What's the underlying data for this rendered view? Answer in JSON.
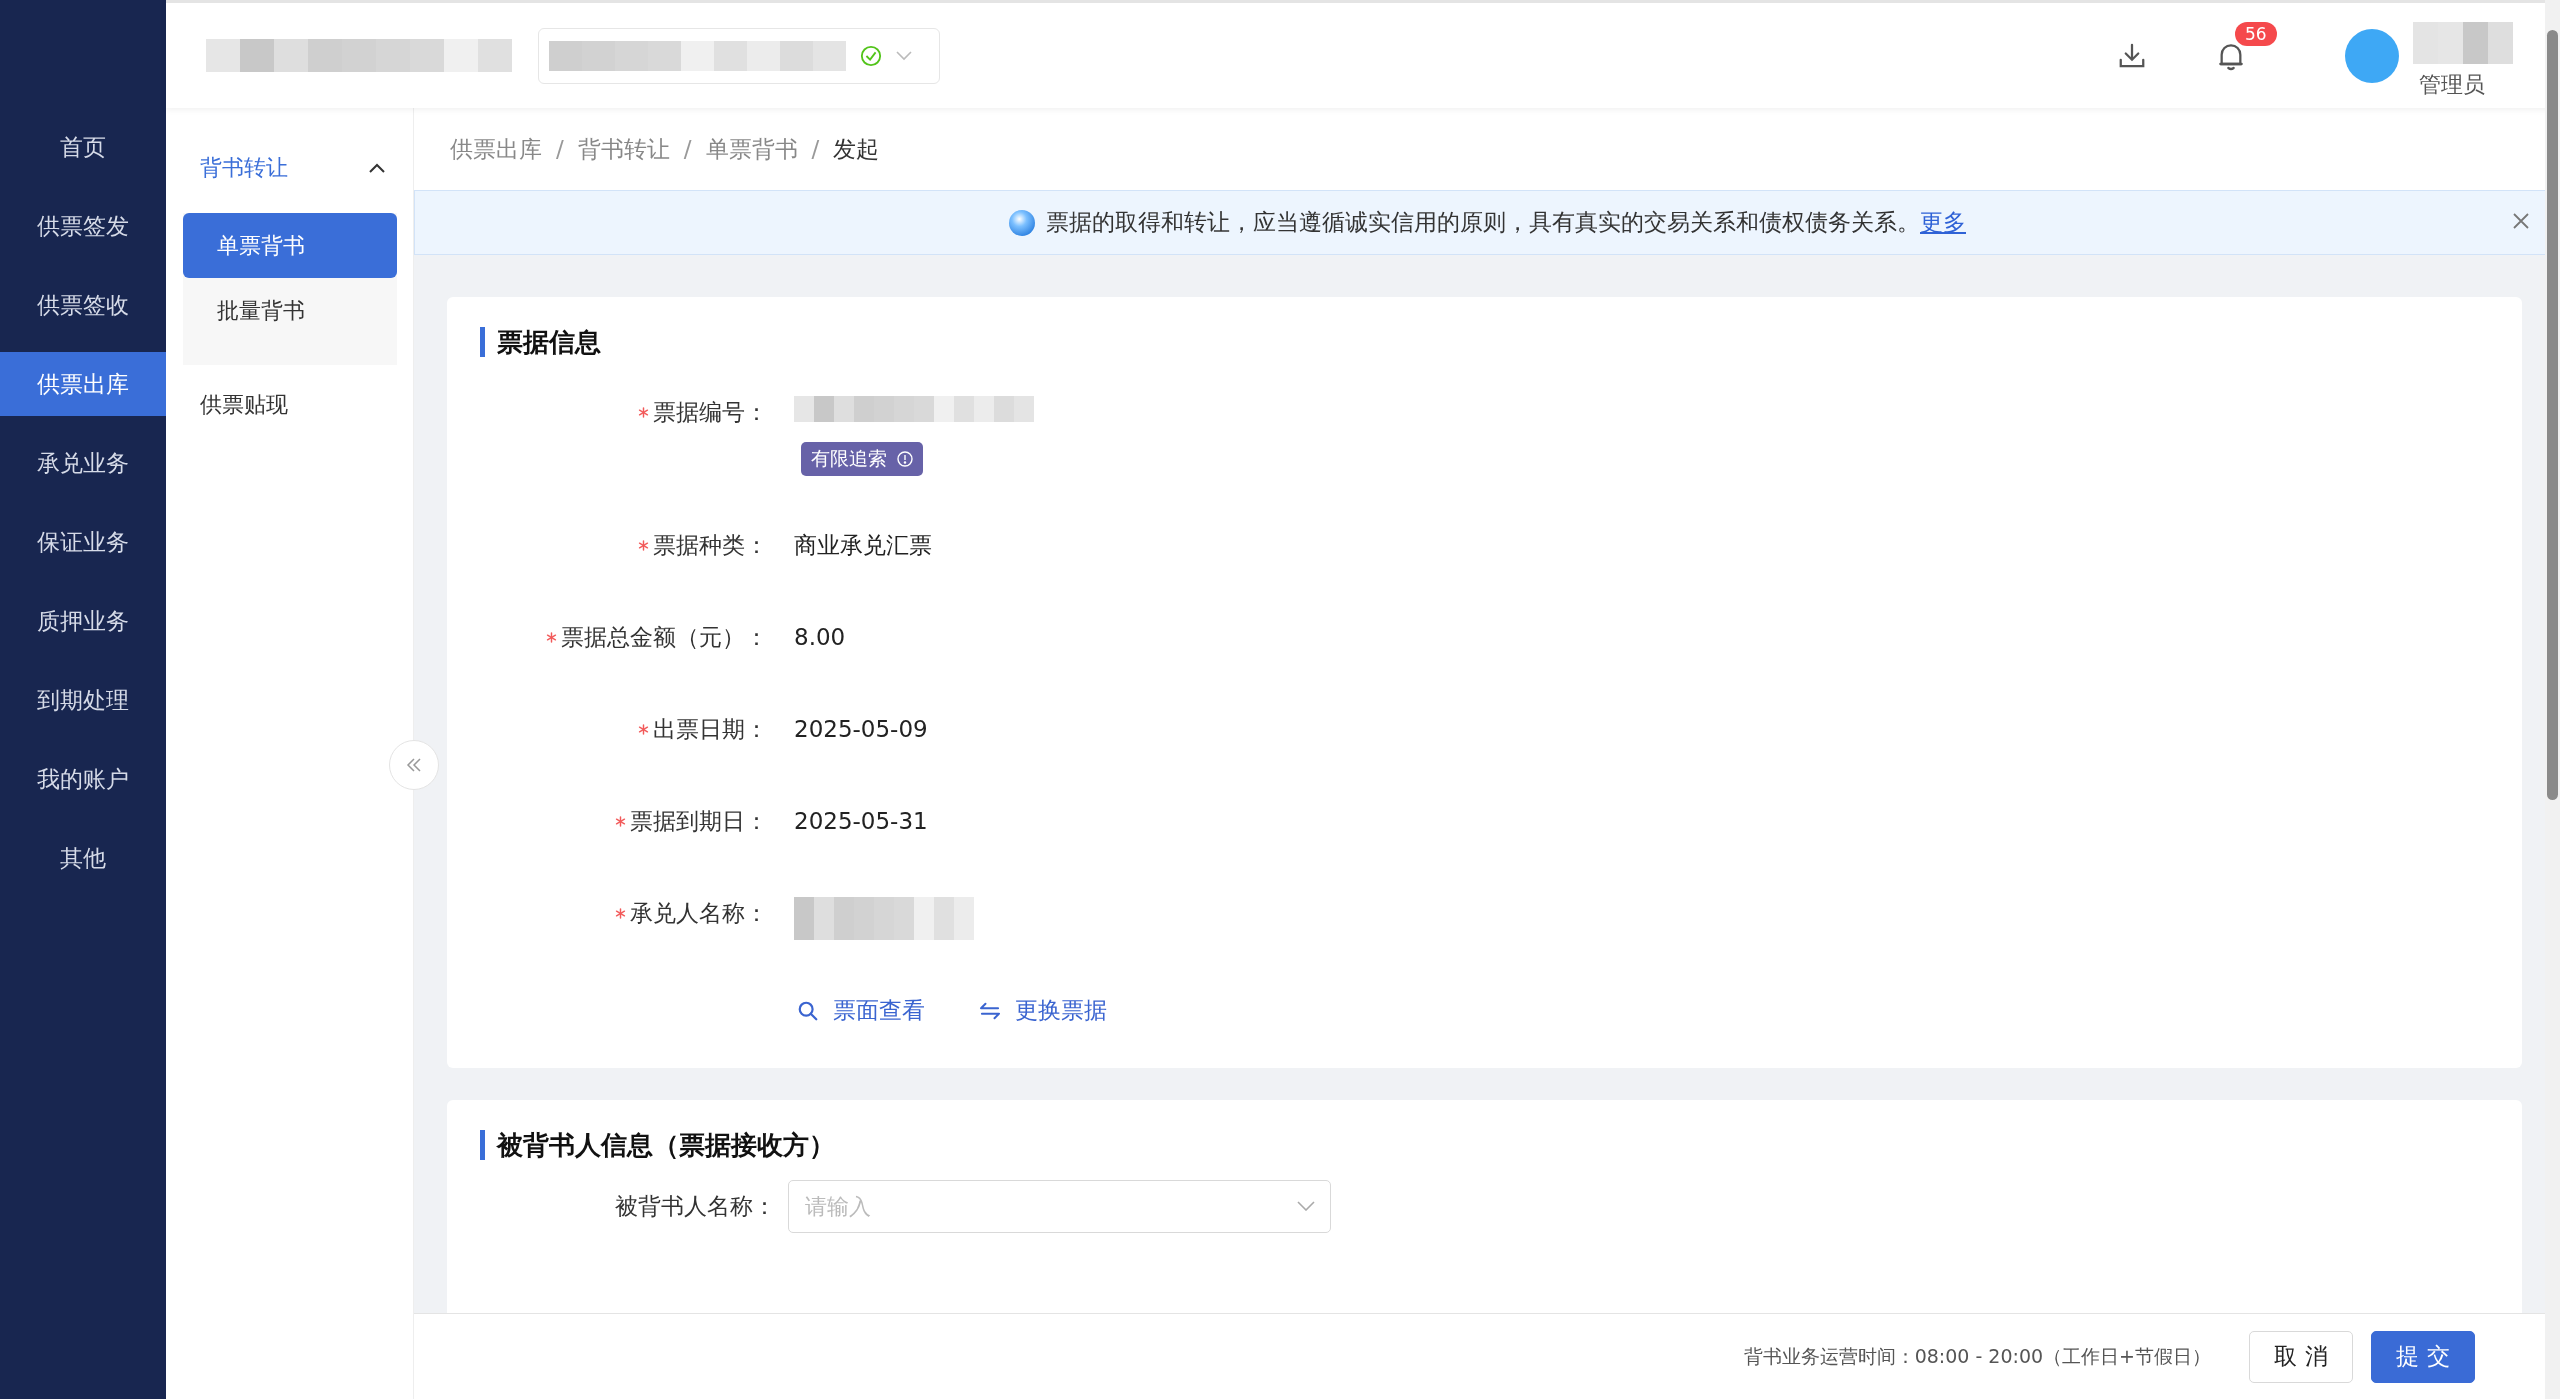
{
  "nav": [
    {
      "label": "首页",
      "selected": false
    },
    {
      "label": "供票签发",
      "selected": false
    },
    {
      "label": "供票签收",
      "selected": false
    },
    {
      "label": "供票出库",
      "selected": true
    },
    {
      "label": "承兑业务",
      "selected": false
    },
    {
      "label": "保证业务",
      "selected": false
    },
    {
      "label": "质押业务",
      "selected": false
    },
    {
      "label": "到期处理",
      "selected": false
    },
    {
      "label": "我的账户",
      "selected": false
    },
    {
      "label": "其他",
      "selected": false
    }
  ],
  "header": {
    "org_select": {
      "verified": true
    },
    "notification_count": "56",
    "user_role": "管理员"
  },
  "submenu": [
    {
      "label": "背书转让",
      "expanded": true,
      "selected": true,
      "children": [
        {
          "label": "单票背书",
          "selected": true
        },
        {
          "label": "批量背书",
          "selected": false
        }
      ]
    },
    {
      "label": "供票贴现",
      "selected": false
    }
  ],
  "breadcrumb": {
    "items": [
      "供票出库",
      "背书转让",
      "单票背书",
      "发起"
    ],
    "separators": [
      "/",
      "/",
      "/"
    ]
  },
  "alert": {
    "text": "票据的取得和转让，应当遵循诚实信用的原则，具有真实的交易关系和债权债务关系。",
    "link": "更多"
  },
  "bill_info": {
    "title": "票据信息",
    "fields": [
      {
        "label": "票据编号：",
        "required": true,
        "kind": "redacted",
        "tag": "有限追索"
      },
      {
        "label": "票据种类：",
        "required": true,
        "kind": "text",
        "value": "商业承兑汇票"
      },
      {
        "label": "票据总金额（元）：",
        "required": true,
        "kind": "text",
        "value": "8.00"
      },
      {
        "label": "出票日期：",
        "required": true,
        "kind": "text",
        "value": "2025-05-09"
      },
      {
        "label": "票据到期日：",
        "required": true,
        "kind": "text",
        "value": "2025-05-31"
      },
      {
        "label": "承兑人名称：",
        "required": true,
        "kind": "redacted"
      }
    ],
    "actions": [
      {
        "label": "票面查看",
        "kind": "search"
      },
      {
        "label": "更换票据",
        "kind": "swap"
      }
    ]
  },
  "endorsee": {
    "title": "被背书人信息（票据接收方）",
    "fields": [
      {
        "label": "被背书人名称：",
        "placeholder": "请输入"
      }
    ]
  },
  "footer": {
    "note": "背书业务运营时间：08:00 - 20:00（工作日+节假日）",
    "buttons": [
      {
        "label": "取 消",
        "kind": "default"
      },
      {
        "label": "提 交",
        "kind": "primary"
      }
    ]
  }
}
